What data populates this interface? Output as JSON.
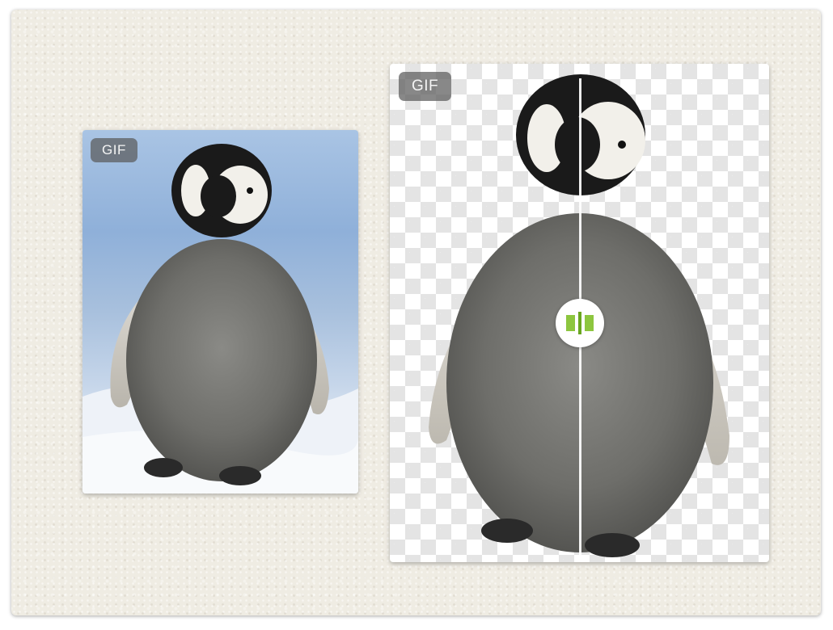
{
  "original_card": {
    "badge_label": "GIF"
  },
  "result_card": {
    "badge_label": "GIF",
    "compare_handle": {
      "icon": "split-compare-icon",
      "position": 0.5
    }
  },
  "colors": {
    "handle_accent": "#8dc63f",
    "badge_bg": "#5a5a5a",
    "checker_gray": "#e4e4e4",
    "paper_bg": "#efece3"
  }
}
